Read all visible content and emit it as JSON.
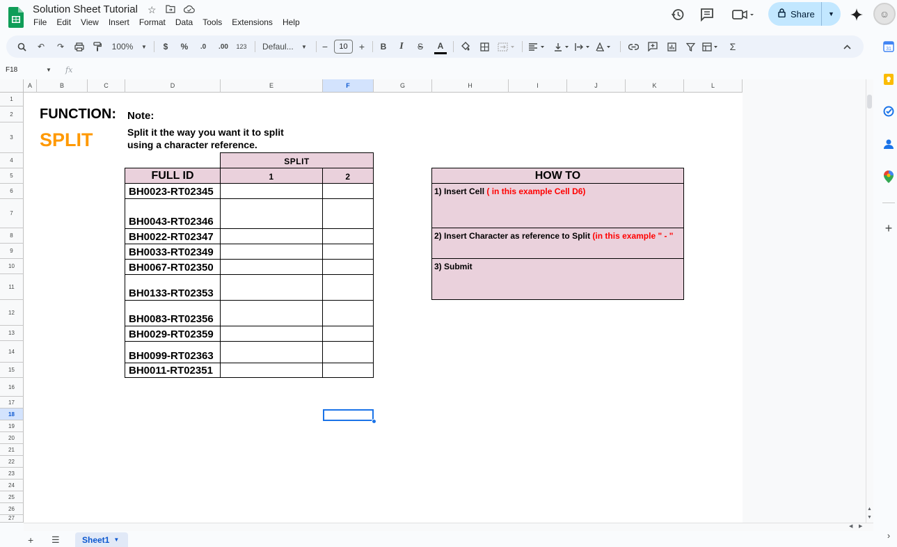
{
  "app": {
    "title": "Solution Sheet Tutorial",
    "menu": [
      "File",
      "Edit",
      "View",
      "Insert",
      "Format",
      "Data",
      "Tools",
      "Extensions",
      "Help"
    ],
    "share_label": "Share"
  },
  "toolbar": {
    "zoom": "100%",
    "currency": "$",
    "percent": "%",
    "dec_decrease": ".0",
    "dec_increase": ".00",
    "number_format": "123",
    "font": "Defaul...",
    "font_size": "10",
    "minus": "−",
    "plus": "+",
    "bold": "B",
    "italic": "I",
    "strike": "S",
    "text_color": "A",
    "sum": "Σ"
  },
  "formula_bar": {
    "cell_ref": "F18",
    "fx": "fx"
  },
  "columns": [
    "A",
    "B",
    "C",
    "D",
    "E",
    "F",
    "G",
    "H",
    "I",
    "J",
    "K",
    "L"
  ],
  "rows": [
    "1",
    "2",
    "3",
    "4",
    "5",
    "6",
    "7",
    "8",
    "9",
    "10",
    "11",
    "12",
    "13",
    "14",
    "15",
    "16",
    "17",
    "18",
    "19",
    "20",
    "21",
    "22",
    "23",
    "24",
    "25",
    "26",
    "27"
  ],
  "selected": {
    "column": "F",
    "row": "18"
  },
  "sheet": {
    "function_label": "FUNCTION:",
    "split_label": "SPLIT",
    "note_label": "Note:",
    "note_line1": "Split it the way you want it to split",
    "note_line2": "using a character reference.",
    "split_header": "SPLIT",
    "full_id_header": "FULL ID",
    "col1_header": "1",
    "col2_header": "2",
    "ids": [
      "BH0023-RT02345",
      "BH0043-RT02346",
      "BH0022-RT02347",
      "BH0033-RT02349",
      "BH0067-RT02350",
      "BH0133-RT02353",
      "BH0083-RT02356",
      "BH0029-RT02359",
      "BH0099-RT02363",
      "BH0011-RT02351"
    ],
    "howto": {
      "header": "HOW TO",
      "step1": "1) Insert Cell",
      "step1_red": " ( in this example Cell D6)",
      "step2": "2) Insert Character as reference to Split",
      "step2_red": " (in this example \" - \"",
      "step3": "3) Submit"
    }
  },
  "tabs": {
    "sheet_name": "Sheet1"
  },
  "colors": {
    "pink_fill": "#ead1dc",
    "split_orange": "#ff9900",
    "share_bg": "#c2e7ff",
    "selection_blue": "#1a73e8"
  }
}
